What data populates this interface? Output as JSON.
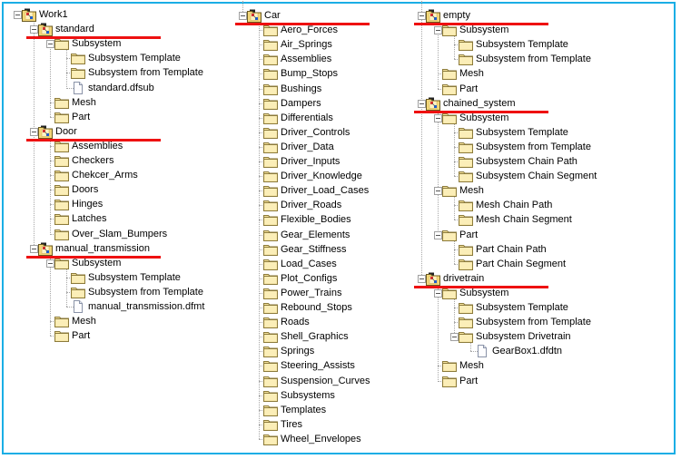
{
  "colors": {
    "frame_border": "#1aaee5",
    "highlight_underline": "#ee1111",
    "folder_fill": "#f7e49a",
    "folder_stroke": "#8a7a3a"
  },
  "columns": [
    {
      "nodes": [
        {
          "label": "Work1",
          "level": 0,
          "icon": "project-icon",
          "expanded": true
        },
        {
          "label": "standard",
          "level": 1,
          "icon": "project-icon",
          "expanded": true,
          "underlined": true
        },
        {
          "label": "Subsystem",
          "level": 2,
          "icon": "folder-icon",
          "expanded": true
        },
        {
          "label": "Subsystem Template",
          "level": 3,
          "icon": "folder-icon"
        },
        {
          "label": "Subsystem from Template",
          "level": 3,
          "icon": "folder-icon"
        },
        {
          "label": "standard.dfsub",
          "level": 3,
          "icon": "file-icon"
        },
        {
          "label": "Mesh",
          "level": 2,
          "icon": "folder-icon"
        },
        {
          "label": "Part",
          "level": 2,
          "icon": "folder-icon"
        },
        {
          "label": "Door",
          "level": 1,
          "icon": "project-icon",
          "expanded": true,
          "underlined": true
        },
        {
          "label": "Assemblies",
          "level": 2,
          "icon": "folder-icon"
        },
        {
          "label": "Checkers",
          "level": 2,
          "icon": "folder-icon"
        },
        {
          "label": "Chekcer_Arms",
          "level": 2,
          "icon": "folder-icon"
        },
        {
          "label": "Doors",
          "level": 2,
          "icon": "folder-icon"
        },
        {
          "label": "Hinges",
          "level": 2,
          "icon": "folder-icon"
        },
        {
          "label": "Latches",
          "level": 2,
          "icon": "folder-icon"
        },
        {
          "label": "Over_Slam_Bumpers",
          "level": 2,
          "icon": "folder-icon"
        },
        {
          "label": "manual_transmission",
          "level": 1,
          "icon": "project-icon",
          "expanded": true,
          "underlined": true
        },
        {
          "label": "Subsystem",
          "level": 2,
          "icon": "folder-icon",
          "expanded": true
        },
        {
          "label": "Subsystem Template",
          "level": 3,
          "icon": "folder-icon"
        },
        {
          "label": "Subsystem from Template",
          "level": 3,
          "icon": "folder-icon"
        },
        {
          "label": "manual_transmission.dfmt",
          "level": 3,
          "icon": "file-icon"
        },
        {
          "label": "Mesh",
          "level": 2,
          "icon": "folder-icon"
        },
        {
          "label": "Part",
          "level": 2,
          "icon": "folder-icon"
        }
      ]
    },
    {
      "nodes": [
        {
          "label": "Car",
          "level": 1,
          "icon": "project-icon",
          "expanded": true,
          "underlined": true
        },
        {
          "label": "Aero_Forces",
          "level": 2,
          "icon": "folder-icon"
        },
        {
          "label": "Air_Springs",
          "level": 2,
          "icon": "folder-icon"
        },
        {
          "label": "Assemblies",
          "level": 2,
          "icon": "folder-icon"
        },
        {
          "label": "Bump_Stops",
          "level": 2,
          "icon": "folder-icon"
        },
        {
          "label": "Bushings",
          "level": 2,
          "icon": "folder-icon"
        },
        {
          "label": "Dampers",
          "level": 2,
          "icon": "folder-icon"
        },
        {
          "label": "Differentials",
          "level": 2,
          "icon": "folder-icon"
        },
        {
          "label": "Driver_Controls",
          "level": 2,
          "icon": "folder-icon"
        },
        {
          "label": "Driver_Data",
          "level": 2,
          "icon": "folder-icon"
        },
        {
          "label": "Driver_Inputs",
          "level": 2,
          "icon": "folder-icon"
        },
        {
          "label": "Driver_Knowledge",
          "level": 2,
          "icon": "folder-icon"
        },
        {
          "label": "Driver_Load_Cases",
          "level": 2,
          "icon": "folder-icon"
        },
        {
          "label": "Driver_Roads",
          "level": 2,
          "icon": "folder-icon"
        },
        {
          "label": "Flexible_Bodies",
          "level": 2,
          "icon": "folder-icon"
        },
        {
          "label": "Gear_Elements",
          "level": 2,
          "icon": "folder-icon"
        },
        {
          "label": "Gear_Stiffness",
          "level": 2,
          "icon": "folder-icon"
        },
        {
          "label": "Load_Cases",
          "level": 2,
          "icon": "folder-icon"
        },
        {
          "label": "Plot_Configs",
          "level": 2,
          "icon": "folder-icon"
        },
        {
          "label": "Power_Trains",
          "level": 2,
          "icon": "folder-icon"
        },
        {
          "label": "Rebound_Stops",
          "level": 2,
          "icon": "folder-icon"
        },
        {
          "label": "Roads",
          "level": 2,
          "icon": "folder-icon"
        },
        {
          "label": "Shell_Graphics",
          "level": 2,
          "icon": "folder-icon"
        },
        {
          "label": "Springs",
          "level": 2,
          "icon": "folder-icon"
        },
        {
          "label": "Steering_Assists",
          "level": 2,
          "icon": "folder-icon"
        },
        {
          "label": "Suspension_Curves",
          "level": 2,
          "icon": "folder-icon"
        },
        {
          "label": "Subsystems",
          "level": 2,
          "icon": "folder-icon"
        },
        {
          "label": "Templates",
          "level": 2,
          "icon": "folder-icon"
        },
        {
          "label": "Tires",
          "level": 2,
          "icon": "folder-icon"
        },
        {
          "label": "Wheel_Envelopes",
          "level": 2,
          "icon": "folder-icon"
        }
      ]
    },
    {
      "nodes": [
        {
          "label": "empty",
          "level": 1,
          "icon": "project-icon",
          "expanded": true,
          "underlined": true
        },
        {
          "label": "Subsystem",
          "level": 2,
          "icon": "folder-icon",
          "expanded": true
        },
        {
          "label": "Subsystem Template",
          "level": 3,
          "icon": "folder-icon"
        },
        {
          "label": "Subsystem from Template",
          "level": 3,
          "icon": "folder-icon"
        },
        {
          "label": "Mesh",
          "level": 2,
          "icon": "folder-icon"
        },
        {
          "label": "Part",
          "level": 2,
          "icon": "folder-icon"
        },
        {
          "label": "chained_system",
          "level": 1,
          "icon": "project-icon",
          "expanded": true,
          "underlined": true
        },
        {
          "label": "Subsystem",
          "level": 2,
          "icon": "folder-icon",
          "expanded": true
        },
        {
          "label": "Subsystem Template",
          "level": 3,
          "icon": "folder-icon"
        },
        {
          "label": "Subsystem from Template",
          "level": 3,
          "icon": "folder-icon"
        },
        {
          "label": "Subsystem Chain Path",
          "level": 3,
          "icon": "folder-icon"
        },
        {
          "label": "Subsystem Chain Segment",
          "level": 3,
          "icon": "folder-icon"
        },
        {
          "label": "Mesh",
          "level": 2,
          "icon": "folder-icon",
          "expanded": true
        },
        {
          "label": "Mesh Chain Path",
          "level": 3,
          "icon": "folder-icon"
        },
        {
          "label": "Mesh Chain Segment",
          "level": 3,
          "icon": "folder-icon"
        },
        {
          "label": "Part",
          "level": 2,
          "icon": "folder-icon",
          "expanded": true
        },
        {
          "label": "Part Chain Path",
          "level": 3,
          "icon": "folder-icon"
        },
        {
          "label": "Part Chain Segment",
          "level": 3,
          "icon": "folder-icon"
        },
        {
          "label": "drivetrain",
          "level": 1,
          "icon": "project-icon",
          "expanded": true,
          "underlined": true
        },
        {
          "label": "Subsystem",
          "level": 2,
          "icon": "folder-icon",
          "expanded": true
        },
        {
          "label": "Subsystem Template",
          "level": 3,
          "icon": "folder-icon"
        },
        {
          "label": "Subsystem from Template",
          "level": 3,
          "icon": "folder-icon"
        },
        {
          "label": "Subsystem Drivetrain",
          "level": 3,
          "icon": "folder-icon",
          "expanded": true
        },
        {
          "label": "GearBox1.dfdtn",
          "level": 4,
          "icon": "file-icon"
        },
        {
          "label": "Mesh",
          "level": 2,
          "icon": "folder-icon"
        },
        {
          "label": "Part",
          "level": 2,
          "icon": "folder-icon"
        }
      ]
    }
  ]
}
